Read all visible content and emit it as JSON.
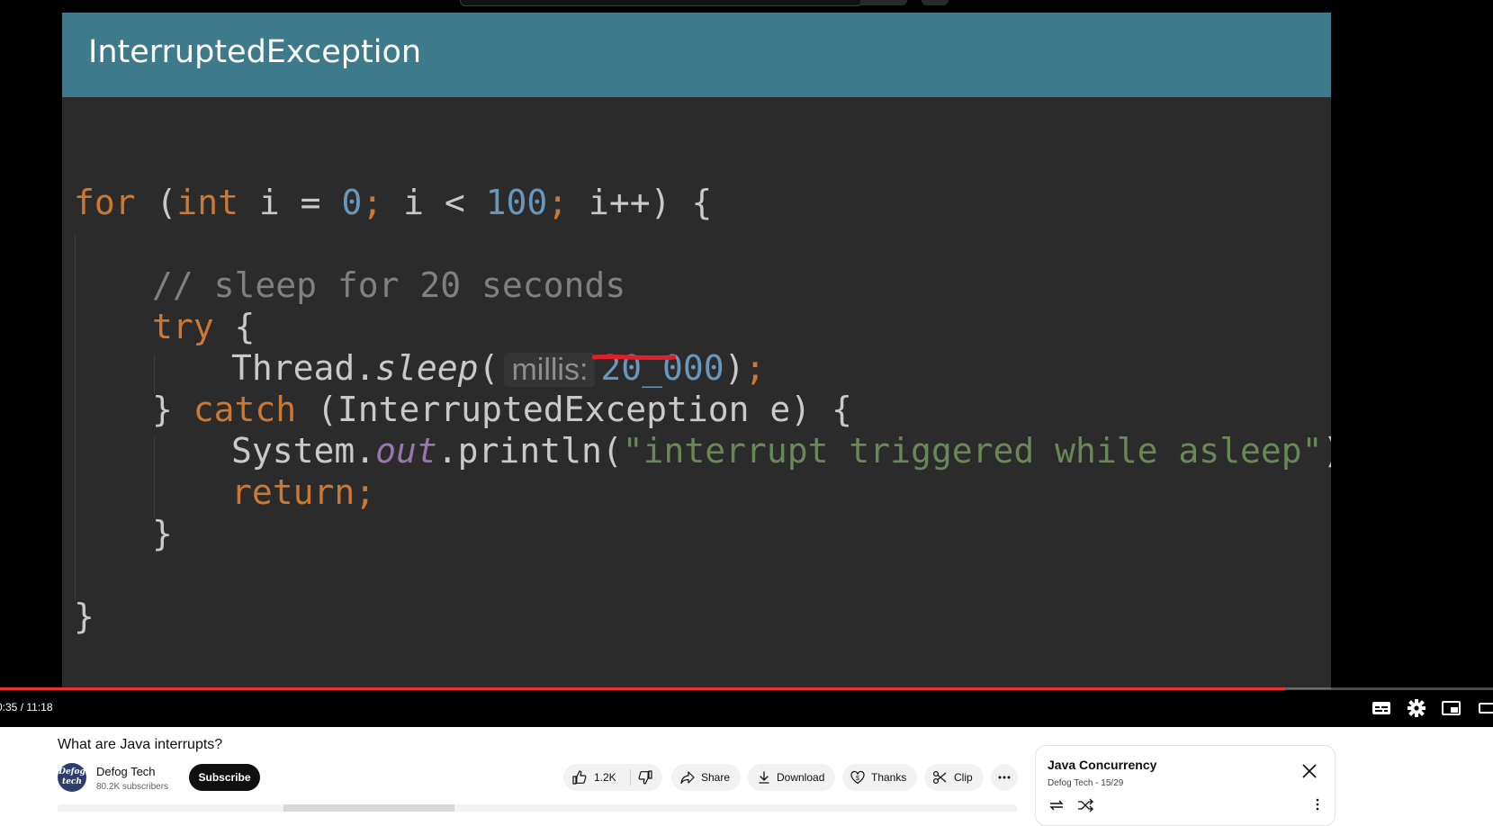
{
  "slide": {
    "title": "InterruptedException",
    "code": [
      [
        {
          "c": "kw",
          "t": "for "
        },
        {
          "c": "txt",
          "t": "("
        },
        {
          "c": "kw",
          "t": "int"
        },
        {
          "c": "txt",
          "t": " i = "
        },
        {
          "c": "num",
          "t": "0"
        },
        {
          "c": "kw",
          "t": ";"
        },
        {
          "c": "txt",
          "t": " i < "
        },
        {
          "c": "num",
          "t": "100"
        },
        {
          "c": "kw",
          "t": ";"
        },
        {
          "c": "txt",
          "t": " i++) {"
        }
      ],
      [
        {
          "c": "cmt",
          "t": "// sleep for 20 seconds"
        }
      ],
      [
        {
          "c": "kw",
          "t": "try"
        },
        {
          "c": "txt",
          "t": " {"
        }
      ],
      [
        {
          "c": "txt",
          "t": "Thread."
        },
        {
          "c": "ital",
          "t": "sleep"
        },
        {
          "c": "txt",
          "t": "("
        },
        {
          "c": "hint",
          "t": "millis:"
        },
        {
          "c": "num",
          "t": "20_000"
        },
        {
          "c": "txt",
          "t": ")"
        },
        {
          "c": "kw",
          "t": ";"
        }
      ],
      [
        {
          "c": "txt",
          "t": "} "
        },
        {
          "c": "kw",
          "t": "catch"
        },
        {
          "c": "txt",
          "t": " (InterruptedException e) {"
        }
      ],
      [
        {
          "c": "txt",
          "t": "System."
        },
        {
          "c": "field",
          "t": "out"
        },
        {
          "c": "txt",
          "t": ".println("
        },
        {
          "c": "str",
          "t": "\"interrupt triggered while asleep\""
        },
        {
          "c": "txt",
          "t": ")"
        },
        {
          "c": "kw",
          "t": ";"
        }
      ],
      [
        {
          "c": "kw",
          "t": "return;"
        }
      ],
      [
        {
          "c": "txt",
          "t": "}"
        }
      ],
      [
        {
          "c": "txt",
          "t": "}"
        }
      ]
    ]
  },
  "player": {
    "time": "0:35 / 11:18",
    "progress": 0.861,
    "controls": [
      "subtitles-icon",
      "settings-icon",
      "miniplayer-icon",
      "theater-icon"
    ]
  },
  "video": {
    "title": "What are Java interrupts?",
    "channel": {
      "avatar_text": "Defog tech",
      "name": "Defog Tech",
      "subscribers": "80.2K subscribers",
      "subscribe_label": "Subscribe"
    },
    "actions": {
      "like_count": "1.2K",
      "share_label": "Share",
      "download_label": "Download",
      "thanks_label": "Thanks",
      "clip_label": "Clip"
    }
  },
  "playlist": {
    "title": "Java Concurrency",
    "meta": "Defog Tech - 15/29"
  },
  "colors": {
    "slide_header": "#3d7a8b",
    "slide_bg": "#2b2b2b",
    "keyword": "#cc7832",
    "number": "#6897bb",
    "string": "#6a8759",
    "comment": "#808080",
    "progress": "#f03030",
    "annotation_stroke": "#e0202a"
  }
}
